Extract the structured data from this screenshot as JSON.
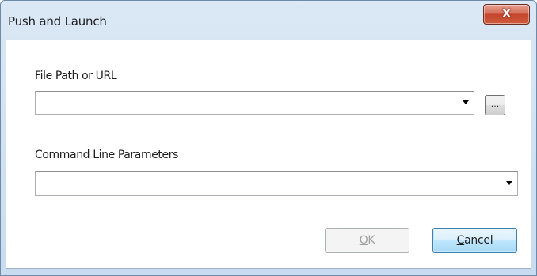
{
  "window": {
    "title": "Push and Launch",
    "close_glyph": "X"
  },
  "form": {
    "file_path_label": "File Path or URL",
    "file_path_value": "",
    "browse_label": "...",
    "command_line_label": "Command Line Parameters",
    "command_line_value": ""
  },
  "buttons": {
    "ok_mnemonic": "O",
    "ok_rest": "K",
    "ok_enabled": false,
    "cancel_mnemonic": "C",
    "cancel_rest": "ancel"
  },
  "icons": {
    "close": "close-icon",
    "dropdown": "chevron-down-icon"
  }
}
